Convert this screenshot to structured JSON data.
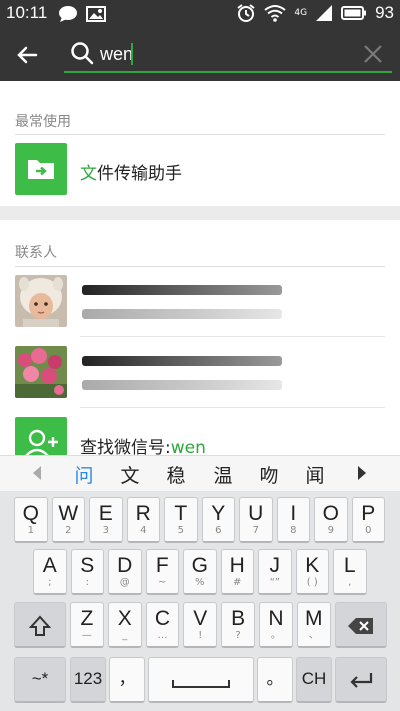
{
  "status_bar": {
    "time": "10:11",
    "battery_percent": "93",
    "network_label": "4G"
  },
  "search": {
    "query": "wen",
    "accent_color": "#2ea73c"
  },
  "frequent": {
    "header": "最常使用",
    "item": {
      "highlight": "文",
      "rest": "件传输助手"
    }
  },
  "contacts": {
    "header": "联系人",
    "lookup": {
      "prefix": "查找微信号:",
      "term": "wen"
    }
  },
  "candidates": [
    "问",
    "文",
    "稳",
    "温",
    "吻",
    "闻"
  ],
  "keyboard": {
    "row1": [
      {
        "k": "Q",
        "s": "1"
      },
      {
        "k": "W",
        "s": "2"
      },
      {
        "k": "E",
        "s": "3"
      },
      {
        "k": "R",
        "s": "4"
      },
      {
        "k": "T",
        "s": "5"
      },
      {
        "k": "Y",
        "s": "6"
      },
      {
        "k": "U",
        "s": "7"
      },
      {
        "k": "I",
        "s": "8"
      },
      {
        "k": "O",
        "s": "9"
      },
      {
        "k": "P",
        "s": "0"
      }
    ],
    "row2": [
      {
        "k": "A",
        "s": ";"
      },
      {
        "k": "S",
        "s": ":"
      },
      {
        "k": "D",
        "s": "@"
      },
      {
        "k": "F",
        "s": "~"
      },
      {
        "k": "G",
        "s": "%"
      },
      {
        "k": "H",
        "s": "#"
      },
      {
        "k": "J",
        "s": "“”"
      },
      {
        "k": "K",
        "s": "( )"
      },
      {
        "k": "L",
        "s": ","
      }
    ],
    "row3": [
      {
        "k": "Z",
        "s": "—"
      },
      {
        "k": "X",
        "s": "_"
      },
      {
        "k": "C",
        "s": "…"
      },
      {
        "k": "V",
        "s": "!"
      },
      {
        "k": "B",
        "s": "?"
      },
      {
        "k": "N",
        "s": "。"
      },
      {
        "k": "M",
        "s": "、"
      }
    ],
    "symbols_key": "~*",
    "numbers_key": "123",
    "comma_key": "，",
    "period_key": "。",
    "lang_key": "CH"
  }
}
